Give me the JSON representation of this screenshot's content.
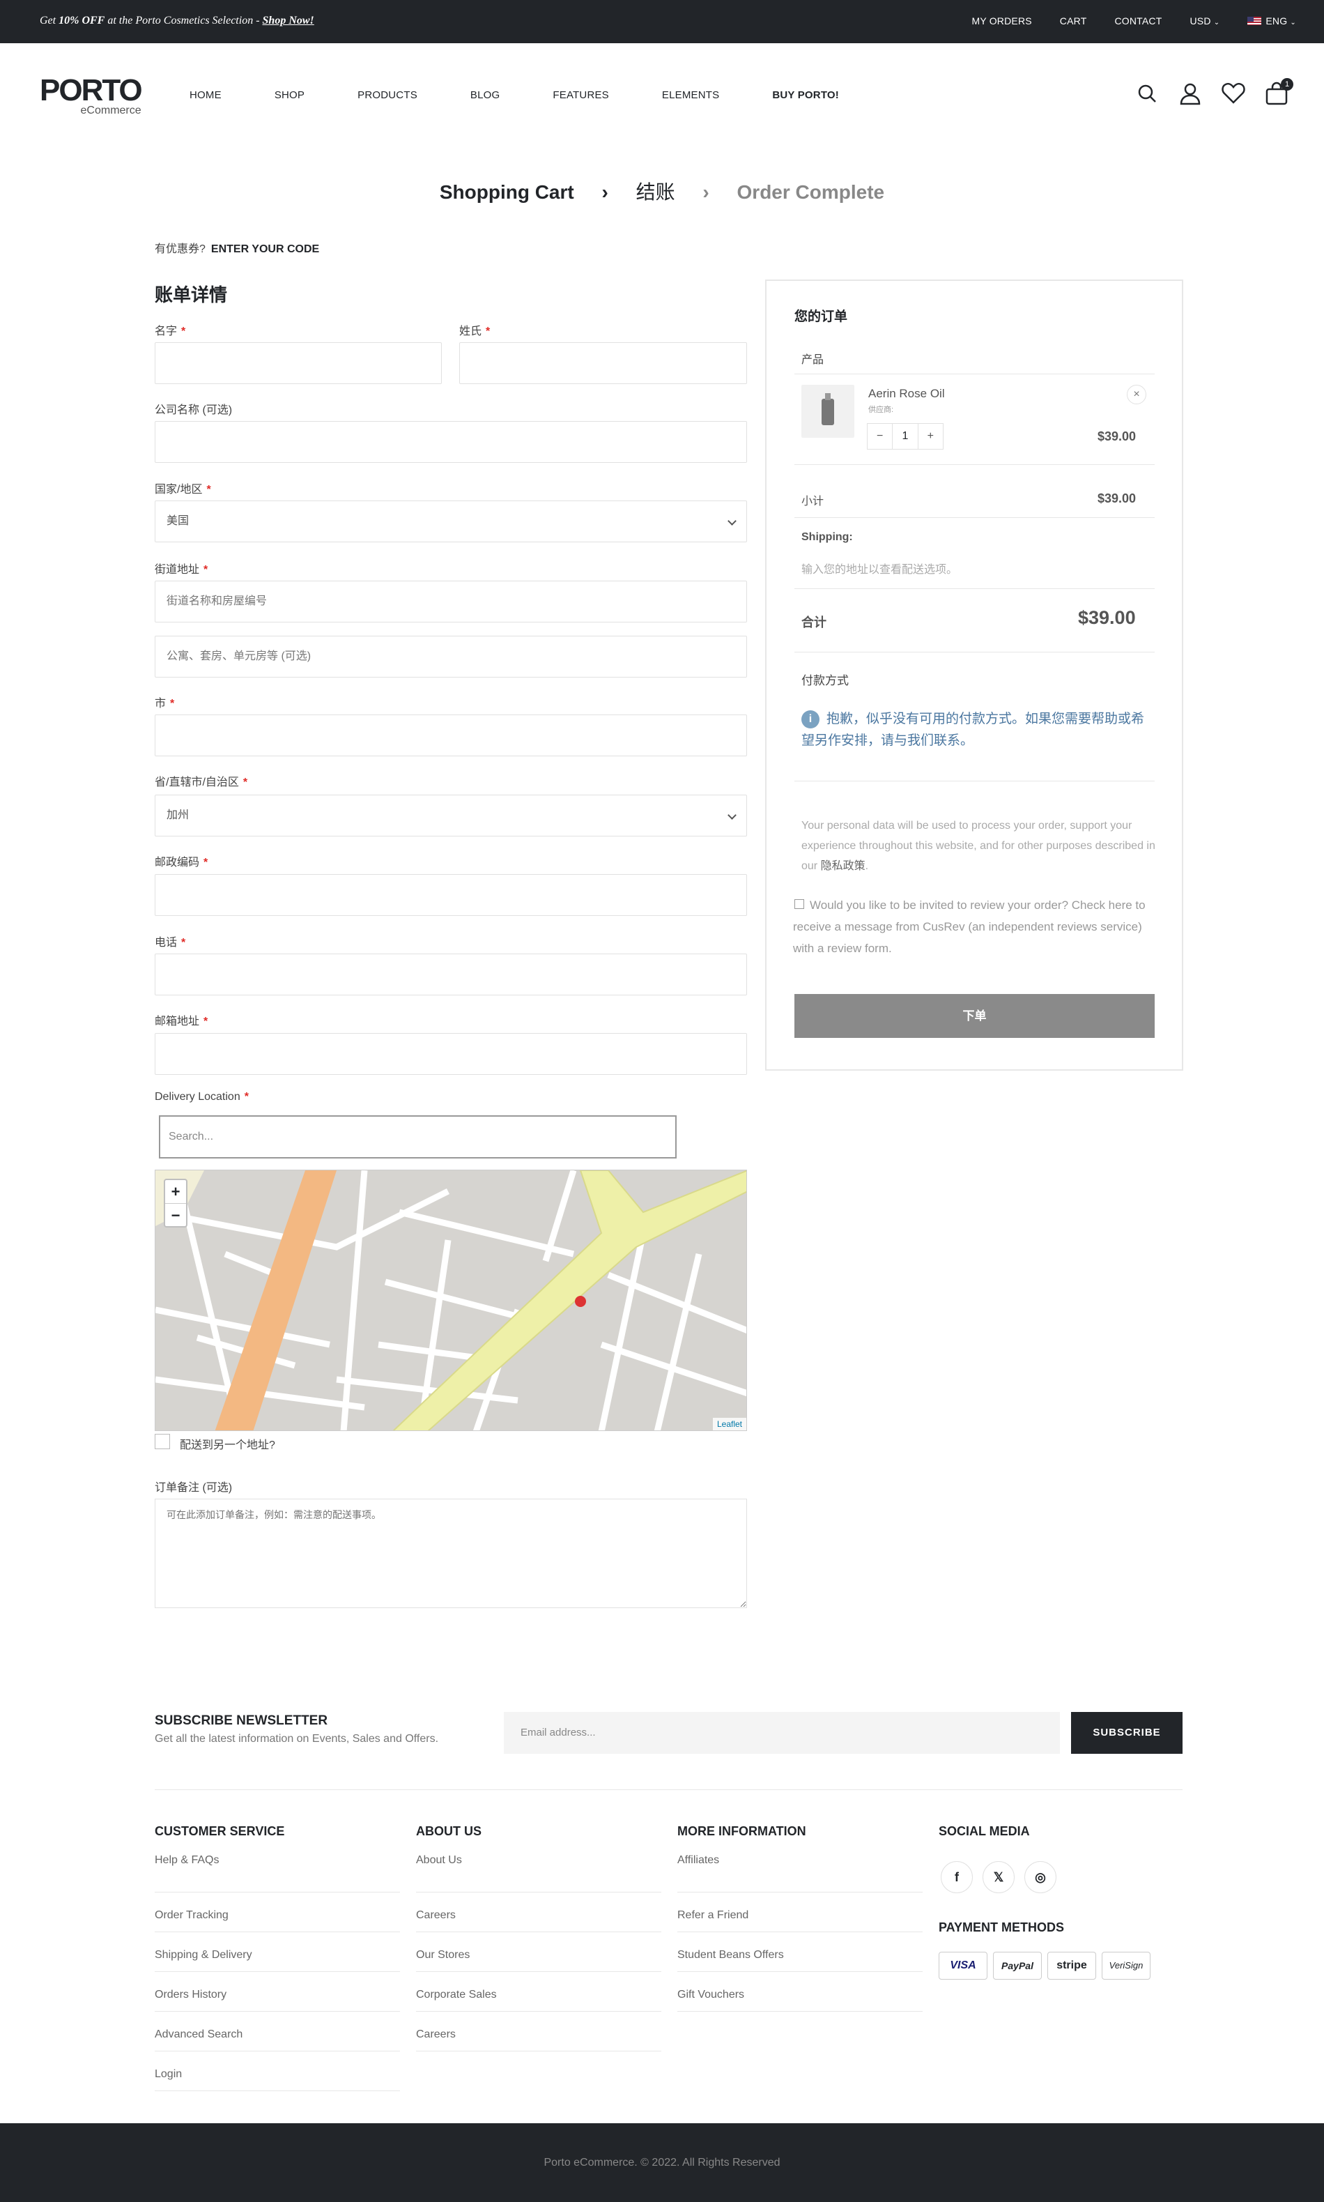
{
  "topbar": {
    "promo_prefix": "Get ",
    "promo_bold": "10% OFF",
    "promo_mid": " at the Porto Cosmetics Selection - ",
    "promo_link": "Shop Now!",
    "links": [
      "MY ORDERS",
      "CART",
      "CONTACT"
    ],
    "currency": "USD",
    "language": "ENG"
  },
  "header": {
    "logo_main": "PORTO",
    "logo_sub": "eCommerce",
    "nav": [
      "HOME",
      "SHOP",
      "PRODUCTS",
      "BLOG",
      "FEATURES",
      "ELEMENTS",
      "BUY PORTO!"
    ],
    "cart_count": "1"
  },
  "steps": {
    "step1": "Shopping Cart",
    "step2": "结账",
    "step3": "Order Complete"
  },
  "coupon": {
    "question": "有优惠券?",
    "link": "ENTER YOUR CODE"
  },
  "billing": {
    "title": "账单详情",
    "first_name": "名字",
    "last_name": "姓氏",
    "company": "公司名称 (可选)",
    "country_label": "国家/地区",
    "country_value": "美国",
    "street_label": "街道地址",
    "street_ph1": "街道名称和房屋编号",
    "street_ph2": "公寓、套房、单元房等 (可选)",
    "city": "市",
    "state_label": "省/直辖市/自治区",
    "state_value": "加州",
    "zip": "邮政编码",
    "phone": "电话",
    "email": "邮箱地址",
    "delivery_label": "Delivery Location",
    "search_ph": "Search...",
    "zoom_in": "+",
    "zoom_out": "−",
    "map_attrib": "Leaflet",
    "ship_other": "配送到另一个地址?",
    "notes_label": "订单备注 (可选)",
    "notes_ph": "可在此添加订单备注，例如：需注意的配送事项。"
  },
  "order": {
    "title": "您的订单",
    "product_header": "产品",
    "product_name": "Aerin Rose Oil",
    "product_vendor": "供应商:",
    "qty": "1",
    "minus": "−",
    "plus": "+",
    "remove": "×",
    "product_price": "$39.00",
    "subtotal_label": "小计",
    "subtotal": "$39.00",
    "shipping_label": "Shipping:",
    "shipping_note": "输入您的地址以查看配送选项。",
    "total_label": "合计",
    "total": "$39.00",
    "payment_label": "付款方式",
    "payment_notice": "抱歉，似乎没有可用的付款方式。如果您需要帮助或希望另作安排，请与我们联系。",
    "privacy_text": "Your personal data will be used to process your order, support your experience throughout this website, and for other purposes described in our ",
    "privacy_link": "隐私政策",
    "privacy_end": ".",
    "review_text": "Would you like to be invited to review your order? Check here to receive a message from CusRev (an independent reviews service) with a review form.",
    "place_order": "下单"
  },
  "newsletter": {
    "title": "SUBSCRIBE NEWSLETTER",
    "sub": "Get all the latest information on Events, Sales and Offers.",
    "email_ph": "Email address...",
    "button": "SUBSCRIBE"
  },
  "footer": {
    "customer_service": {
      "title": "CUSTOMER SERVICE",
      "items": [
        "Help & FAQs",
        "Order Tracking",
        "Shipping & Delivery",
        "Orders History",
        "Advanced Search",
        "Login"
      ]
    },
    "about": {
      "title": "ABOUT US",
      "items": [
        "About Us",
        "Careers",
        "Our Stores",
        "Corporate Sales",
        "Careers"
      ]
    },
    "more": {
      "title": "MORE INFORMATION",
      "items": [
        "Affiliates",
        "Refer a Friend",
        "Student Beans Offers",
        "Gift Vouchers"
      ]
    },
    "social_title": "SOCIAL MEDIA",
    "payment_title": "PAYMENT METHODS",
    "payments": [
      "VISA",
      "PayPal",
      "stripe",
      "VeriSign"
    ],
    "copyright": "Porto eCommerce. © 2022. All Rights Reserved"
  },
  "colors": {
    "dark": "#222529",
    "required": "#e02b27",
    "notice": "#4b77a0",
    "button_disabled": "#8a8a8a"
  }
}
